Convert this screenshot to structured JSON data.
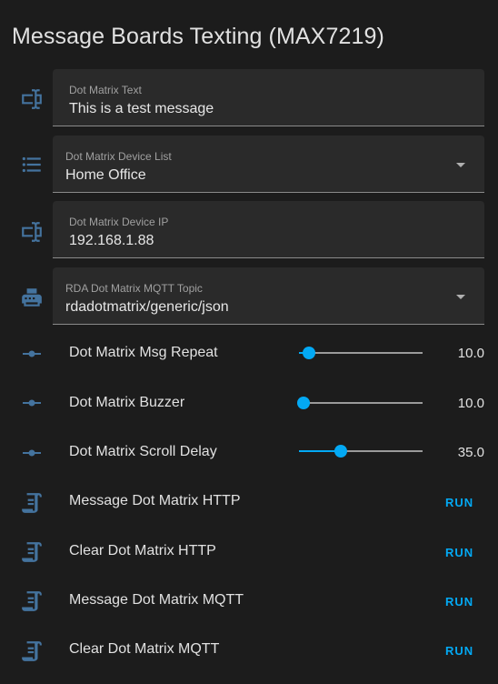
{
  "card": {
    "title": "Message Boards Texting (MAX7219)"
  },
  "fields": [
    {
      "label": "Dot Matrix Text",
      "value": "This is a test message",
      "icon": "textbox-icon"
    },
    {
      "label": "Dot Matrix Device List",
      "value": "Home Office",
      "icon": "list-icon"
    },
    {
      "label": "Dot Matrix Device IP",
      "value": "192.168.1.88",
      "icon": "textbox-icon"
    },
    {
      "label": "RDA Dot Matrix MQTT Topic",
      "value": "rdadotmatrix/generic/json",
      "icon": "printer-icon"
    }
  ],
  "sliders": [
    {
      "label": "Dot Matrix Msg Repeat",
      "value": "10.0",
      "level": 0.08,
      "icon": "slider-icon"
    },
    {
      "label": "Dot Matrix Buzzer",
      "value": "10.0",
      "level": 0.04,
      "icon": "slider-icon"
    },
    {
      "label": "Dot Matrix Scroll Delay",
      "value": "35.0",
      "level": 0.34,
      "icon": "slider-icon"
    }
  ],
  "scripts": [
    {
      "label": "Message Dot Matrix HTTP",
      "action": "RUN",
      "icon": "script-icon"
    },
    {
      "label": "Clear Dot Matrix HTTP",
      "action": "RUN",
      "icon": "script-icon"
    },
    {
      "label": "Message Dot Matrix MQTT",
      "action": "RUN",
      "icon": "script-icon"
    },
    {
      "label": "Clear Dot Matrix MQTT",
      "action": "RUN",
      "icon": "script-icon"
    }
  ],
  "colors": {
    "icon": "#44739e",
    "accent": "#03a9f4",
    "background": "#1c1c1c",
    "field": "#2a2a2a"
  }
}
